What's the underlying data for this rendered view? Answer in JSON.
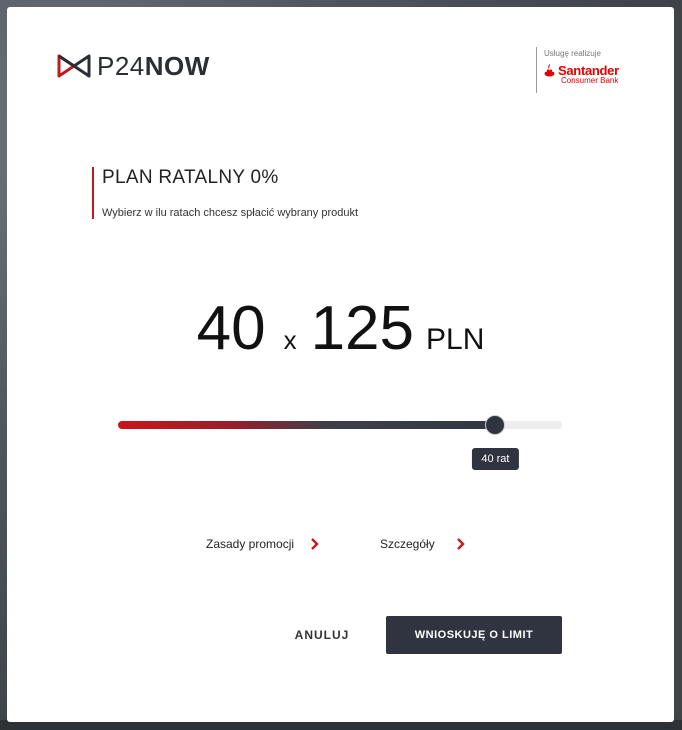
{
  "header": {
    "logo_text_a": "P24",
    "logo_text_b": "NOW",
    "partner_caption": "Usługę realizuje",
    "partner_name": "Santander",
    "partner_sub": "Consumer Bank"
  },
  "plan": {
    "title": "PLAN RATALNY 0%",
    "subtitle": "Wybierz w ilu ratach chcesz spłacić wybrany produkt"
  },
  "amount": {
    "installments": "40",
    "separator": "x",
    "installment_value": "125",
    "currency": "PLN"
  },
  "slider": {
    "level": 0.85,
    "tooltip": "40 rat"
  },
  "links": [
    {
      "label": "Zasady promocji"
    },
    {
      "label": "Szczegóły"
    }
  ],
  "actions": {
    "cancel_label": "ANULUJ",
    "submit_label": "WNIOSKUJĘ O LIMIT"
  },
  "colors": {
    "accent_red": "#c41a1f",
    "dark": "#2f3440",
    "santander_red": "#e60000"
  },
  "icons": {
    "logo": "p24now-logo-icon",
    "partner": "santander-flame-icon",
    "link_arrow": "chevron-right-icon"
  }
}
